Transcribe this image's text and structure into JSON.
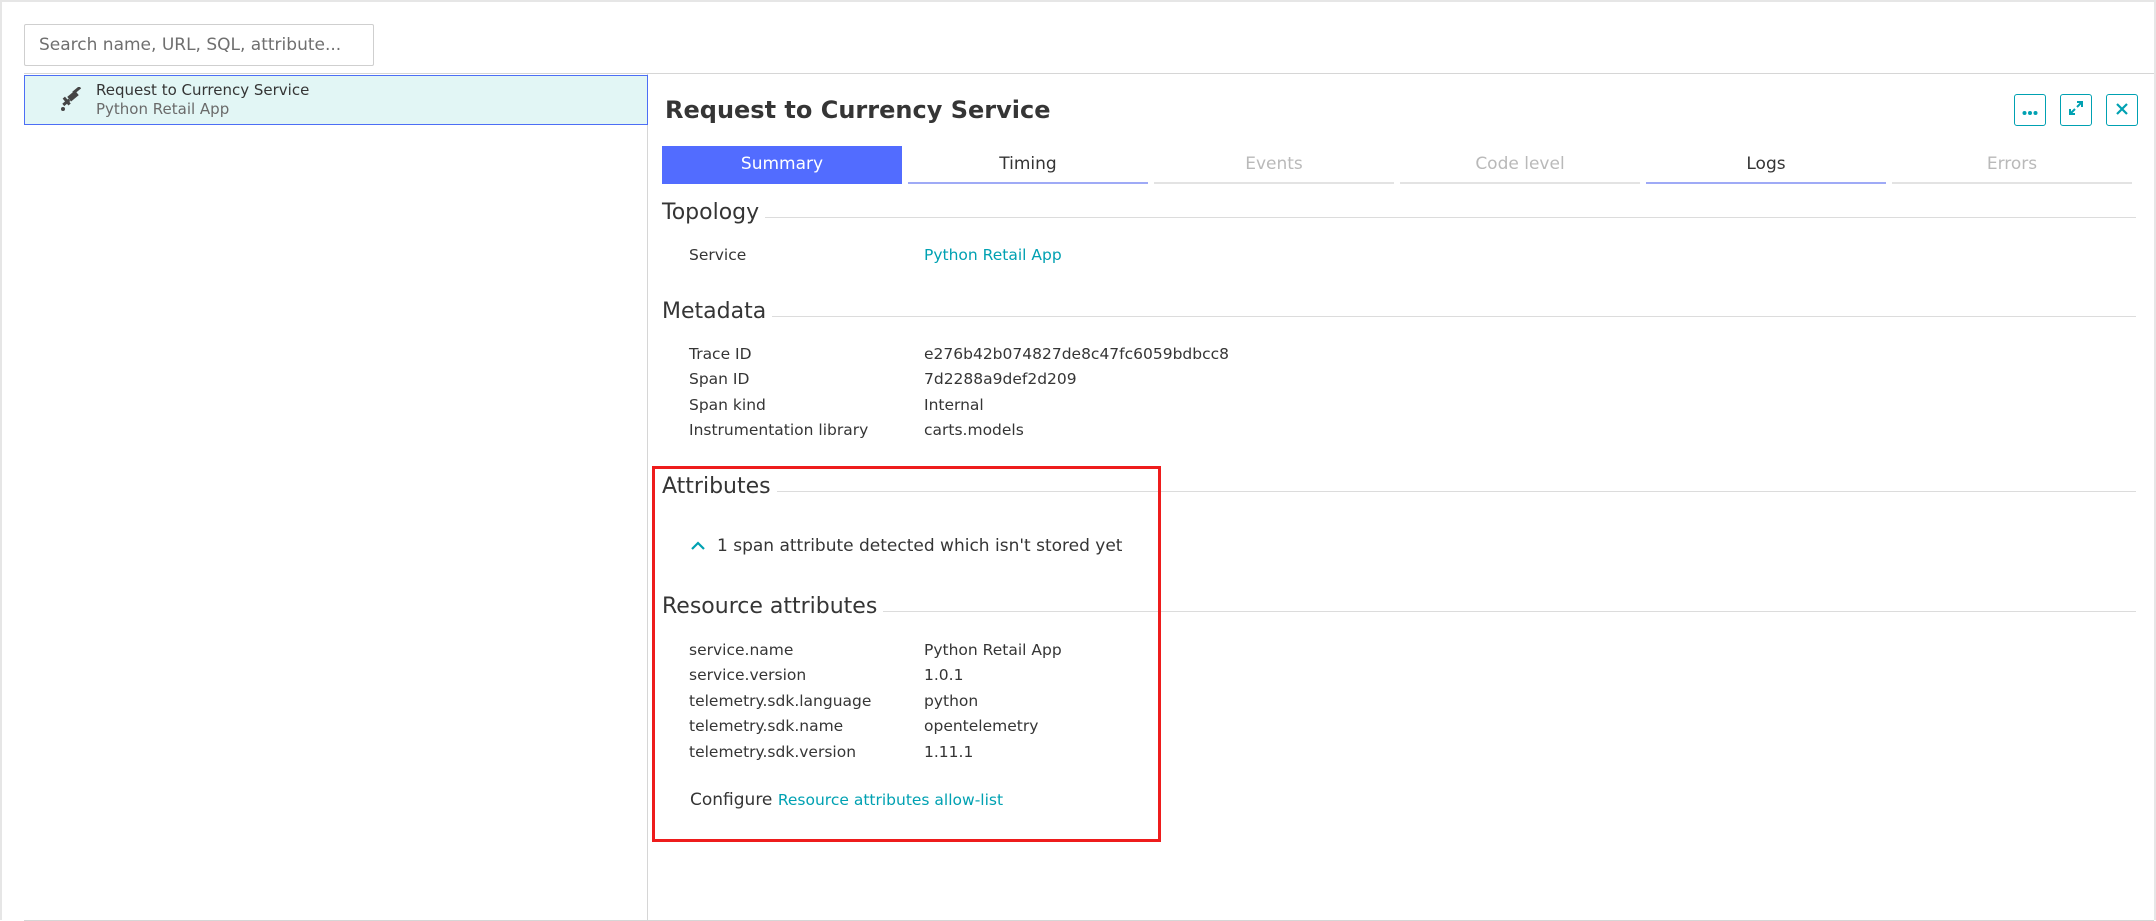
{
  "search": {
    "placeholder": "Search name, URL, SQL, attribute..."
  },
  "list": {
    "items": [
      {
        "title": "Request to Currency Service",
        "subtitle": "Python Retail App",
        "icon": "satellite-icon",
        "selected": true
      }
    ]
  },
  "panel": {
    "title": "Request to Currency Service",
    "actions": [
      "more-icon",
      "expand-icon",
      "close-icon"
    ]
  },
  "tabs": [
    {
      "label": "Summary",
      "state": "active"
    },
    {
      "label": "Timing",
      "state": "enabled"
    },
    {
      "label": "Events",
      "state": "disabled"
    },
    {
      "label": "Code level",
      "state": "disabled"
    },
    {
      "label": "Logs",
      "state": "enabled"
    },
    {
      "label": "Errors",
      "state": "disabled"
    }
  ],
  "topology": {
    "heading": "Topology",
    "rows": [
      {
        "key": "Service",
        "value": "Python Retail App",
        "link": true
      }
    ]
  },
  "metadata": {
    "heading": "Metadata",
    "rows": [
      {
        "key": "Trace ID",
        "value": "e276b42b074827de8c47fc6059bdbcc8"
      },
      {
        "key": "Span ID",
        "value": "7d2288a9def2d209"
      },
      {
        "key": "Span kind",
        "value": "Internal"
      },
      {
        "key": "Instrumentation library",
        "value": "carts.models"
      }
    ]
  },
  "attributes": {
    "heading": "Attributes",
    "notice": "1 span attribute detected which isn't stored yet"
  },
  "resource_attributes": {
    "heading": "Resource attributes",
    "rows": [
      {
        "key": "service.name",
        "value": "Python Retail App"
      },
      {
        "key": "service.version",
        "value": "1.0.1"
      },
      {
        "key": "telemetry.sdk.language",
        "value": "python"
      },
      {
        "key": "telemetry.sdk.name",
        "value": "opentelemetry"
      },
      {
        "key": "telemetry.sdk.version",
        "value": "1.11.1"
      }
    ],
    "configure_label": "Configure",
    "configure_link": "Resource attributes allow-list"
  },
  "colors": {
    "accent": "#526cff",
    "link": "#00a1b2",
    "selected_bg": "#e2f6f5",
    "highlight": "#ee1c1c"
  }
}
